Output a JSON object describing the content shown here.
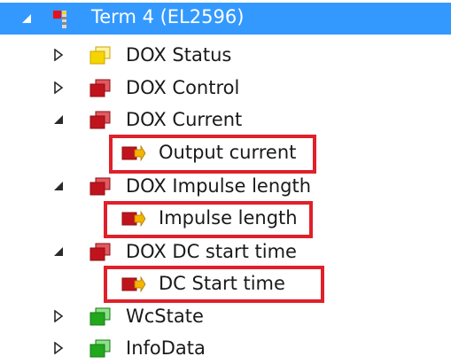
{
  "tree": {
    "root": {
      "label": "Term 4 (EL2596)",
      "icon": "terminal-icon",
      "expanded": true,
      "selected": true
    },
    "items": [
      {
        "label": "DOX Status",
        "icon": "input-folder-icon",
        "expanded": false,
        "color": "#f5d400"
      },
      {
        "label": "DOX Control",
        "icon": "output-folder-icon",
        "expanded": false,
        "color": "#c0141c"
      },
      {
        "label": "DOX Current",
        "icon": "output-folder-icon",
        "expanded": true,
        "color": "#c0141c",
        "child": {
          "label": "Output current",
          "icon": "output-variable-icon"
        }
      },
      {
        "label": "DOX Impulse length",
        "icon": "output-folder-icon",
        "expanded": true,
        "color": "#c0141c",
        "child": {
          "label": "Impulse length",
          "icon": "output-variable-icon"
        }
      },
      {
        "label": "DOX DC start time",
        "icon": "output-folder-icon",
        "expanded": true,
        "color": "#c0141c",
        "child": {
          "label": "DC Start time",
          "icon": "output-variable-icon"
        }
      },
      {
        "label": "WcState",
        "icon": "status-folder-icon",
        "expanded": false,
        "color": "#22a81e"
      },
      {
        "label": "InfoData",
        "icon": "status-folder-icon",
        "expanded": false,
        "color": "#22a81e"
      }
    ]
  },
  "colors": {
    "selection": "#3399ff",
    "highlight_box": "#e0202a",
    "input_yellow": "#f5d400",
    "output_red": "#c0141c",
    "status_green": "#22a81e"
  }
}
